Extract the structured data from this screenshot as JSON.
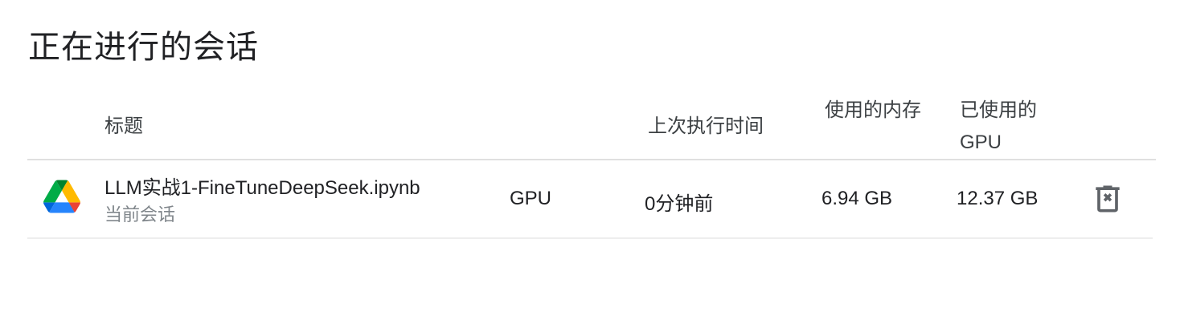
{
  "page": {
    "title": "正在进行的会话"
  },
  "table": {
    "headers": {
      "title": "标题",
      "last_run": "上次执行时间",
      "memory_used": "使用的内存",
      "gpu_used": "已使用的GPU"
    },
    "rows": [
      {
        "icon": "google-drive-icon",
        "name": "LLM实战1-FineTuneDeepSeek.ipynb",
        "subtitle": "当前会话",
        "type": "GPU",
        "last_run": "0分钟前",
        "memory_used": "6.94 GB",
        "gpu_used": "12.37 GB",
        "action_icon": "delete-icon"
      }
    ]
  },
  "colors": {
    "drive_green": "#1ea362",
    "drive_blue": "#4285f4",
    "drive_yellow": "#ffba00",
    "drive_red": "#ea4335",
    "icon_gray": "#5f6368"
  }
}
